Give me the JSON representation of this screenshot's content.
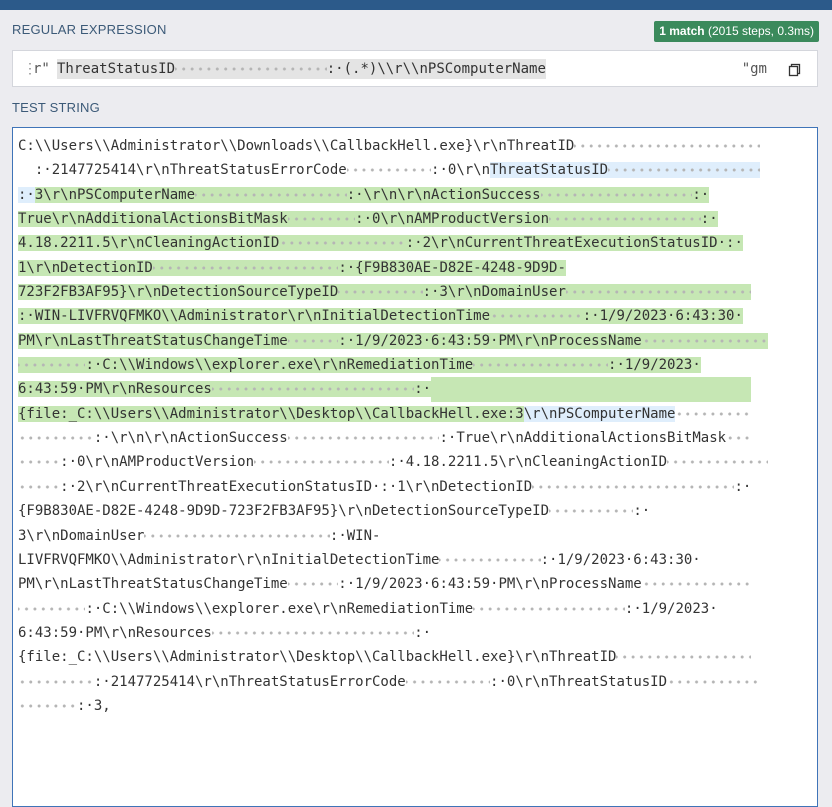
{
  "header": {
    "regex_label": "REGULAR EXPRESSION",
    "test_label": "TEST STRING",
    "match_badge_strong": "1 match",
    "match_badge_detail": " (2015 steps, 0.3ms)"
  },
  "regex": {
    "delimiter_open": "r\"",
    "pattern_before": "ThreatStatusID",
    "pattern_dots": 18,
    "pattern_after": ":·(.*)\\\\r\\\\nPSComputerName",
    "flags": "\"gm"
  },
  "test_string": {
    "lines": [
      [
        [
          "n",
          "C:\\\\Users\\\\Administrator\\\\Downloads\\\\CallbackHell.exe}\\r\\nThreatID"
        ],
        [
          "n",
          "·",
          22
        ]
      ],
      [
        [
          "n",
          "",
          2
        ],
        [
          "n",
          ":·2147725414\\r\\nThreatStatusErrorCode"
        ],
        [
          "n",
          "·",
          10
        ],
        [
          "n",
          ":·0\\r\\n"
        ],
        [
          "g",
          "ThreatStatusID"
        ],
        [
          "g",
          "·",
          18
        ]
      ],
      [
        [
          "g",
          ":·"
        ],
        [
          "m",
          "3\\r\\nPSComputerName"
        ],
        [
          "m",
          "·",
          18
        ],
        [
          "m",
          ":·\\r\\n\\r\\nActionSuccess"
        ],
        [
          "m",
          "·",
          18
        ],
        [
          "m",
          ":·"
        ]
      ],
      [
        [
          "m",
          "True\\r\\nAdditionalActionsBitMask"
        ],
        [
          "m",
          "·",
          8
        ],
        [
          "m",
          ":·0\\r\\nAMProductVersion"
        ],
        [
          "m",
          "·",
          18
        ],
        [
          "m",
          ":·"
        ]
      ],
      [
        [
          "m",
          "4.18.2211.5\\r\\nCleaningActionID"
        ],
        [
          "m",
          "·",
          15
        ],
        [
          "m",
          ":·2\\r\\nCurrentThreatExecutionStatusID·:·"
        ]
      ],
      [
        [
          "m",
          "1\\r\\nDetectionID"
        ],
        [
          "m",
          "·",
          22
        ],
        [
          "m",
          ":·{F9B830AE-D82E-4248-9D9D-"
        ]
      ],
      [
        [
          "m",
          "723F2FB3AF95}\\r\\nDetectionSourceTypeID"
        ],
        [
          "m",
          "·",
          10
        ],
        [
          "m",
          ":·3\\r\\nDomainUser"
        ],
        [
          "m",
          "·",
          22
        ]
      ],
      [
        [
          "m",
          ":·WIN-LIVFRVQFMKO\\\\Administrator\\r\\nInitialDetectionTime"
        ],
        [
          "m",
          "·",
          11
        ],
        [
          "m",
          ":·1/9/2023·6:43:30·"
        ]
      ],
      [
        [
          "m",
          "PM\\r\\nLastThreatStatusChangeTime"
        ],
        [
          "m",
          "·",
          6
        ],
        [
          "m",
          ":·1/9/2023·6:43:59·PM\\r\\nProcessName"
        ],
        [
          "m",
          "·",
          15
        ]
      ],
      [
        [
          "m",
          "·",
          8
        ],
        [
          "m",
          ":·C:\\\\Windows\\\\explorer.exe\\r\\nRemediationTime"
        ],
        [
          "m",
          "·",
          16
        ],
        [
          "m",
          ":·1/9/2023·"
        ]
      ],
      [
        [
          "m",
          "6:43:59·PM\\r\\nResources"
        ],
        [
          "m",
          "·",
          24
        ],
        [
          "m",
          ":·"
        ],
        [
          "m",
          "",
          38
        ]
      ],
      [
        [
          "m",
          "{file:_C:\\\\Users\\\\Administrator\\\\Desktop\\\\CallbackHell.exe:3"
        ],
        [
          "g",
          "\\r\\nPSComputerName"
        ],
        [
          "n",
          "·",
          9
        ]
      ],
      [
        [
          "n",
          "·",
          9
        ],
        [
          "n",
          ":·\\r\\n\\r\\nActionSuccess"
        ],
        [
          "n",
          "·",
          18
        ],
        [
          "n",
          ":·True\\r\\nAdditionalActionsBitMask"
        ],
        [
          "n",
          "·",
          3
        ]
      ],
      [
        [
          "n",
          "·",
          5
        ],
        [
          "n",
          ":·0\\r\\nAMProductVersion"
        ],
        [
          "n",
          "·",
          16
        ],
        [
          "n",
          ":·4.18.2211.5\\r\\nCleaningActionID"
        ],
        [
          "n",
          "·",
          12
        ]
      ],
      [
        [
          "n",
          "·",
          5
        ],
        [
          "n",
          ":·2\\r\\nCurrentThreatExecutionStatusID·:·1\\r\\nDetectionID"
        ],
        [
          "n",
          "·",
          24
        ],
        [
          "n",
          ":·"
        ]
      ],
      [
        [
          "n",
          "{F9B830AE-D82E-4248-9D9D-723F2FB3AF95}\\r\\nDetectionSourceTypeID"
        ],
        [
          "n",
          "·",
          10
        ],
        [
          "n",
          ":·"
        ]
      ],
      [
        [
          "n",
          "3\\r\\nDomainUser"
        ],
        [
          "n",
          "·",
          22
        ],
        [
          "n",
          ":·WIN-"
        ]
      ],
      [
        [
          "n",
          "LIVFRVQFMKO\\\\Administrator\\r\\nInitialDetectionTime"
        ],
        [
          "n",
          "·",
          12
        ],
        [
          "n",
          ":·1/9/2023·6:43:30·"
        ]
      ],
      [
        [
          "n",
          "PM\\r\\nLastThreatStatusChangeTime"
        ],
        [
          "n",
          "·",
          6
        ],
        [
          "n",
          ":·1/9/2023·6:43:59·PM\\r\\nProcessName"
        ],
        [
          "n",
          "·",
          13
        ]
      ],
      [
        [
          "n",
          "·",
          8
        ],
        [
          "n",
          ":·C:\\\\Windows\\\\explorer.exe\\r\\nRemediationTime"
        ],
        [
          "n",
          "·",
          18
        ],
        [
          "n",
          ":·1/9/2023·"
        ]
      ],
      [
        [
          "n",
          "6:43:59·PM\\r\\nResources"
        ],
        [
          "n",
          "·",
          24
        ],
        [
          "n",
          ":·"
        ]
      ],
      [
        [
          "n",
          "{file:_C:\\\\Users\\\\Administrator\\\\Desktop\\\\CallbackHell.exe}\\r\\nThreatID"
        ],
        [
          "n",
          "·",
          16
        ]
      ],
      [
        [
          "n",
          "·",
          9
        ],
        [
          "n",
          ":·2147725414\\r\\nThreatStatusErrorCode"
        ],
        [
          "n",
          "·",
          10
        ],
        [
          "n",
          ":·0\\r\\nThreatStatusID"
        ],
        [
          "n",
          "·",
          11
        ]
      ],
      [
        [
          "n",
          "·",
          7
        ],
        [
          "n",
          ":·3,"
        ]
      ]
    ]
  },
  "colors": {
    "match": "#c6e7b4",
    "group_highlight": "#dfeefc",
    "badge": "#3b8a5c",
    "header_bar": "#2c5a8a",
    "border_active": "#3f74b8"
  },
  "icons": {
    "copy": "copy-icon",
    "drag": "drag-handle-icon"
  }
}
